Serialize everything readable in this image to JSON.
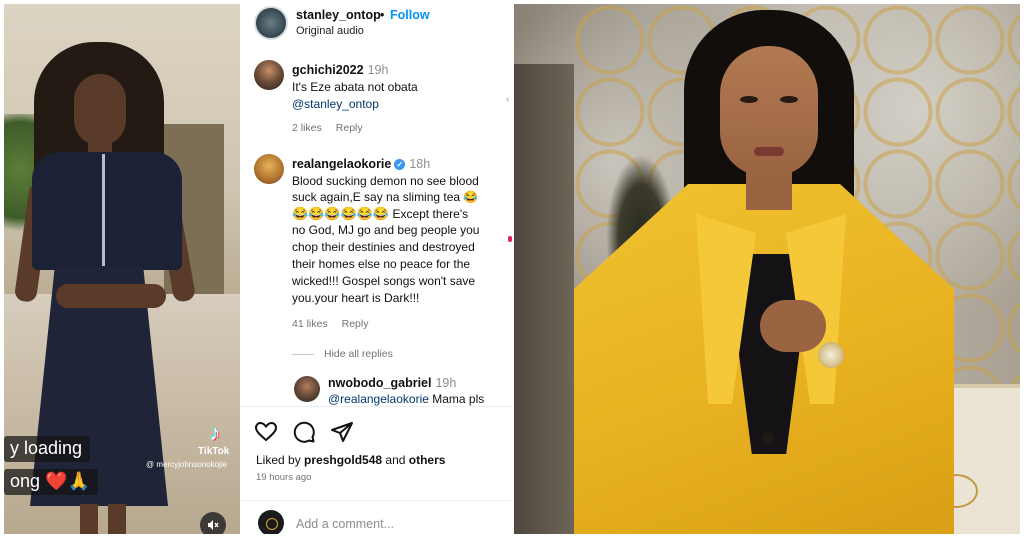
{
  "left_panel": {
    "caption_line1": "y loading",
    "caption_line2": "ong ❤️🙏",
    "tiktok_label": "TikTok",
    "tiktok_handle": "@ mercyjohnsonokojie"
  },
  "instagram": {
    "header": {
      "username": "stanley_ontop",
      "dot": "•",
      "follow_label": "Follow",
      "subtitle": "Original audio"
    },
    "comments": [
      {
        "username": "gchichi2022",
        "time": "19h",
        "text_line": "It's Eze abata not obata",
        "mention": "@stanley_ontop",
        "likes": "2 likes",
        "reply": "Reply"
      },
      {
        "username": "realangelaokorie",
        "verified": "✓",
        "time": "18h",
        "text1": "Blood sucking demon no see blood",
        "text2": "suck again,E say na sliming tea 😂",
        "text3_emojis": "😂😂😂😂😂😂",
        "text3": " Except there's",
        "text4": "no God, MJ go and beg people you",
        "text5": "chop their destinies and destroyed",
        "text6": "their homes else no peace for the",
        "text7": "wicked!!! Gospel songs won't save",
        "text8": "you.your heart is Dark!!!",
        "likes": "41 likes",
        "reply": "Reply"
      }
    ],
    "hide_replies": "Hide all replies",
    "reply": {
      "username": "nwobodo_gabriel",
      "time": "19h",
      "mention": "@realangelaokorie",
      "text": " Mama pls"
    },
    "liked_by_prefix": "Liked by ",
    "liked_by_user": "preshgold548",
    "liked_by_mid": " and ",
    "liked_by_others": "others",
    "age": "19 hours ago",
    "add_comment_placeholder": "Add a comment..."
  },
  "icons": [
    "heart-icon",
    "comment-icon",
    "share-icon",
    "mute-icon",
    "tiktok-icon",
    "verified-icon"
  ],
  "colors": {
    "follow_blue": "#0095f6",
    "mention_blue": "#00376b",
    "verified_blue": "#3897f0",
    "jacket_yellow": "#f1c230"
  }
}
